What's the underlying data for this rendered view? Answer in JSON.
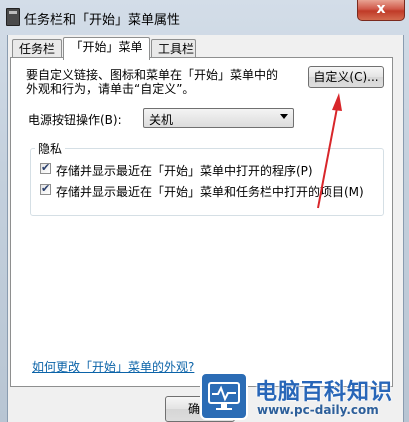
{
  "window": {
    "title": "任务栏和「开始」菜单属性",
    "close_label": "x"
  },
  "tabs": [
    {
      "label": "任务栏"
    },
    {
      "label": "「开始」菜单"
    },
    {
      "label": "工具栏"
    }
  ],
  "start_menu_tab": {
    "description": "要自定义链接、图标和菜单在「开始」菜单中的\n外观和行为，请单击“自定义”。",
    "customize_button": "自定义(C)...",
    "power_button_label": "电源按钮操作(B):",
    "power_button_value": "关机",
    "privacy_group_label": "隐私",
    "checkboxes": [
      {
        "label": "存储并显示最近在「开始」菜单中打开的程序(P)",
        "checked": true
      },
      {
        "label": "存储并显示最近在「开始」菜单和任务栏中打开的项目(M)",
        "checked": true
      }
    ],
    "help_link": "如何更改「开始」菜单的外观?",
    "ok_button": "确定"
  },
  "annotation": {
    "arrow_color": "#d8262a"
  },
  "watermark": {
    "name": "电脑百科知识",
    "url": "www.pc-daily.com",
    "color": "#2866b8"
  }
}
